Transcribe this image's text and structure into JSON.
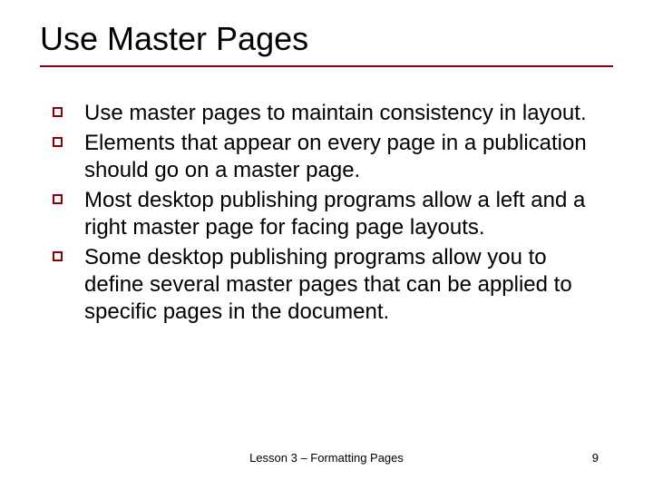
{
  "title": "Use Master Pages",
  "bullets": [
    "Use master pages to maintain consistency in layout.",
    "Elements that appear on every page in a publication should go on a master page.",
    "Most desktop publishing programs allow a left and a right master page for facing page layouts.",
    "Some desktop publishing programs allow you to define several master pages that can be applied to specific pages in the document."
  ],
  "footer": "Lesson 3 – Formatting Pages",
  "page_number": "9"
}
